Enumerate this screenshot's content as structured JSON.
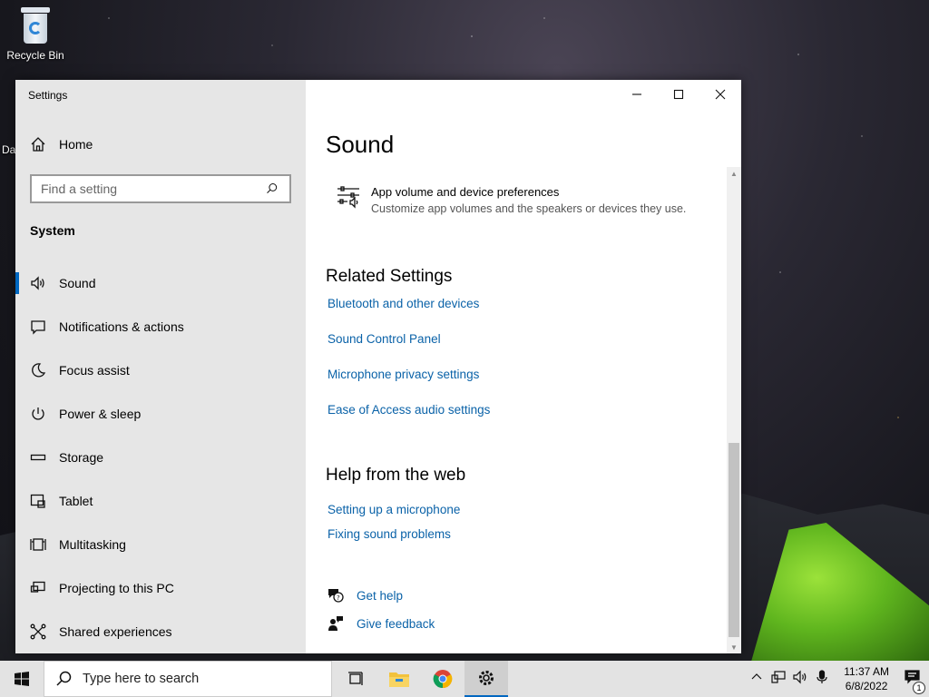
{
  "desktop": {
    "recycle_bin": "Recycle Bin",
    "partial_label": "Da"
  },
  "window": {
    "title": "Settings",
    "controls": [
      "minimize",
      "maximize",
      "close"
    ]
  },
  "sidebar": {
    "home": "Home",
    "search_placeholder": "Find a setting",
    "section": "System",
    "items": [
      {
        "label": "Sound",
        "icon": "speaker-icon",
        "active": true
      },
      {
        "label": "Notifications & actions",
        "icon": "notification-icon"
      },
      {
        "label": "Focus assist",
        "icon": "moon-icon"
      },
      {
        "label": "Power & sleep",
        "icon": "power-icon"
      },
      {
        "label": "Storage",
        "icon": "storage-icon"
      },
      {
        "label": "Tablet",
        "icon": "tablet-icon"
      },
      {
        "label": "Multitasking",
        "icon": "multitasking-icon"
      },
      {
        "label": "Projecting to this PC",
        "icon": "projecting-icon"
      },
      {
        "label": "Shared experiences",
        "icon": "shared-icon"
      }
    ]
  },
  "main": {
    "title": "Sound",
    "app_volume": {
      "title": "App volume and device preferences",
      "description": "Customize app volumes and the speakers or devices they use."
    },
    "related_heading": "Related Settings",
    "related_links": [
      "Bluetooth and other devices",
      "Sound Control Panel",
      "Microphone privacy settings",
      "Ease of Access audio settings"
    ],
    "web_heading": "Help from the web",
    "web_links": [
      "Setting up a microphone",
      "Fixing sound problems"
    ],
    "get_help": "Get help",
    "give_feedback": "Give feedback"
  },
  "taskbar": {
    "search_placeholder": "Type here to search",
    "time": "11:37 AM",
    "date": "6/8/2022",
    "notification_count": "1"
  },
  "colors": {
    "accent": "#0067c0",
    "link": "#0a62a8"
  }
}
